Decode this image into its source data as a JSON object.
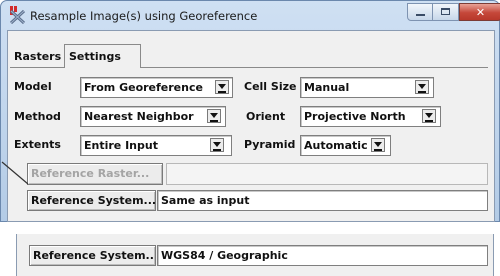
{
  "window": {
    "title": "Resample Image(s) using Georeference",
    "controls": {
      "minimize": "–",
      "maximize": "□",
      "close": "✕"
    }
  },
  "tabs": [
    {
      "label": "Rasters",
      "active": false
    },
    {
      "label": "Settings",
      "active": true
    }
  ],
  "settings": {
    "model": {
      "label": "Model",
      "value": "From Georeference"
    },
    "cell_size": {
      "label": "Cell Size",
      "value": "Manual"
    },
    "method": {
      "label": "Method",
      "value": "Nearest Neighbor"
    },
    "orient": {
      "label": "Orient",
      "value": "Projective North"
    },
    "extents": {
      "label": "Extents",
      "value": "Entire Input"
    },
    "pyramid": {
      "label": "Pyramid",
      "value": "Automatic"
    }
  },
  "reference_raster": {
    "button_label": "Reference Raster...",
    "value": ""
  },
  "reference_system": {
    "button_label": "Reference System...",
    "value": "Same as input"
  },
  "reference_system_alt": {
    "button_label": "Reference System...",
    "value": "WGS84 / Geographic"
  },
  "colors": {
    "window_bg": "#f0f0f0",
    "titlebar_top": "#dbe9f8",
    "titlebar_bottom": "#b9d1ea",
    "close_button": "#c94535"
  }
}
